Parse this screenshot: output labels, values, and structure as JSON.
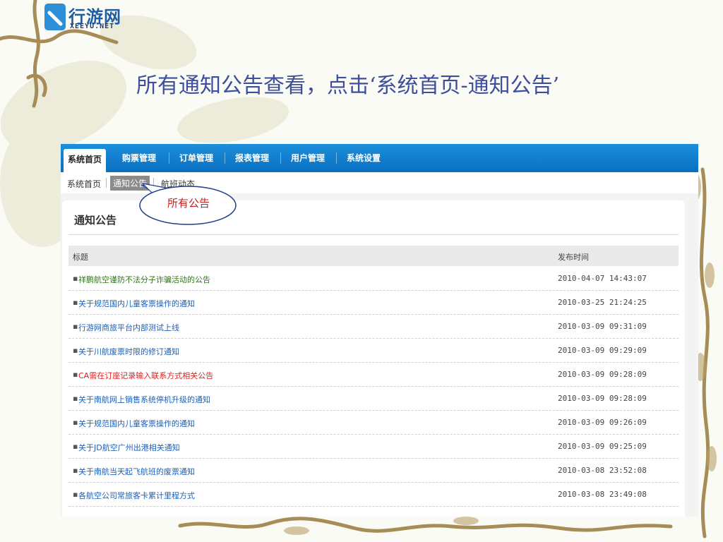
{
  "logo": {
    "name": "行游网",
    "sub": "XEEYU.NET"
  },
  "slide_title": "所有通知公告查看，点击‘系统首页-通知公告’",
  "top_nav": [
    "系统首页",
    "购票管理",
    "订单管理",
    "报表管理",
    "用户管理",
    "系统设置"
  ],
  "sub_nav": [
    "系统首页",
    "通知公告",
    "航班动态"
  ],
  "panel": {
    "title": "通知公告",
    "col_title": "标题",
    "col_date": "发布时间"
  },
  "notices": [
    {
      "title": "祥鹏航空谨防不法分子诈骗活动的公告",
      "date": "2010-04-07 14:43:07",
      "color": "#2d7a14"
    },
    {
      "title": "关于规范国内儿童客票操作的通知",
      "date": "2010-03-25 21:24:25",
      "color": "#1c5fb8"
    },
    {
      "title": "行游网商旅平台内部测试上线",
      "date": "2010-03-09 09:31:09",
      "color": "#1c5fb8"
    },
    {
      "title": "关于川航废票时限的修订通知",
      "date": "2010-03-09 09:29:09",
      "color": "#1c5fb8"
    },
    {
      "title": "CA需在订座记录输入联系方式相关公告",
      "date": "2010-03-09 09:28:09",
      "color": "#e01e1e"
    },
    {
      "title": "关于南航网上销售系统停机升级的通知",
      "date": "2010-03-09 09:28:09",
      "color": "#1c5fb8"
    },
    {
      "title": "关于规范国内儿童客票操作的通知",
      "date": "2010-03-09 09:26:09",
      "color": "#1c5fb8"
    },
    {
      "title": "关于JD航空广州出港相关通知",
      "date": "2010-03-09 09:25:09",
      "color": "#1c5fb8"
    },
    {
      "title": "关于南航当天起飞航班的废票通知",
      "date": "2010-03-08 23:52:08",
      "color": "#1c5fb8"
    },
    {
      "title": "各航空公司常旅客卡累计里程方式",
      "date": "2010-03-08 23:49:08",
      "color": "#1c5fb8"
    }
  ],
  "callout": "所有公告",
  "colors": {
    "nav_blue": "#0a6fc0",
    "title_blue": "#3d4f9c",
    "callout_red": "#cc1f1f"
  }
}
